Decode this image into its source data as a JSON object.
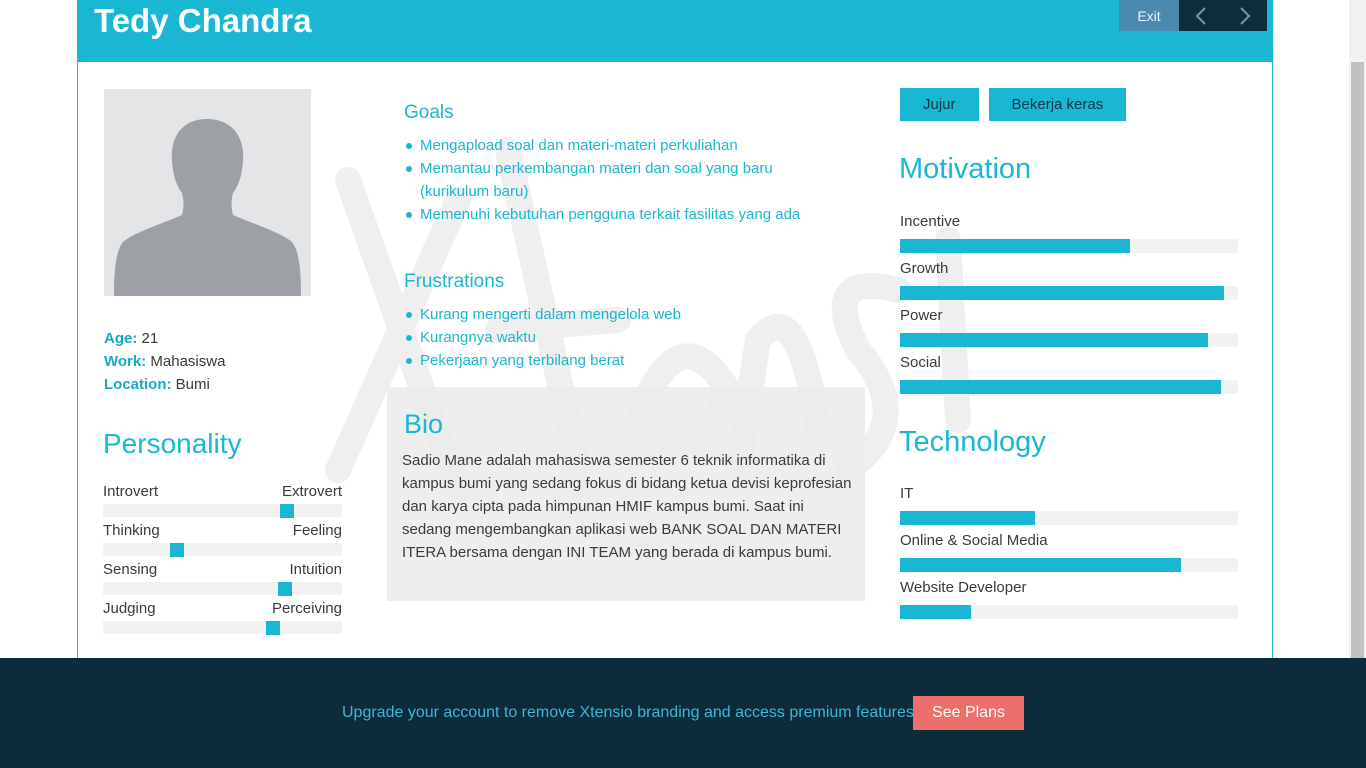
{
  "profile": {
    "name": "Tedy Chandra",
    "age_label": "Age:",
    "age": "21",
    "work_label": "Work:",
    "work": "Mahasiswa",
    "location_label": "Location:",
    "location": "Bumi"
  },
  "nav": {
    "exit": "Exit",
    "prev_icon": "chevron-left-icon",
    "next_icon": "chevron-right-icon"
  },
  "personality": {
    "title": "Personality",
    "traits": [
      {
        "left": "Introvert",
        "right": "Extrovert",
        "value": 0.77
      },
      {
        "left": "Thinking",
        "right": "Feeling",
        "value": 0.31
      },
      {
        "left": "Sensing",
        "right": "Intuition",
        "value": 0.76
      },
      {
        "left": "Judging",
        "right": "Perceiving",
        "value": 0.71
      }
    ]
  },
  "goals": {
    "title": "Goals",
    "items": [
      "Mengapload soal dan materi-materi perkuliahan",
      "Memantau perkembangan materi dan soal yang baru (kurikulum baru)",
      "Memenuhi kebutuhan pengguna terkait fasilitas yang ada"
    ]
  },
  "frustrations": {
    "title": "Frustrations",
    "items": [
      "Kurang mengerti dalam mengelola web",
      "Kurangnya waktu",
      "Pekerjaan yang terbilang berat"
    ]
  },
  "bio": {
    "title": "Bio",
    "text": "Sadio Mane adalah mahasiswa semester 6 teknik informatika di kampus bumi yang sedang fokus di bidang ketua devisi keprofesian dan karya cipta pada himpunan HMIF kampus bumi. Saat ini sedang mengembangkan aplikasi web BANK SOAL DAN MATERI ITERA bersama dengan INI TEAM yang berada di kampus bumi."
  },
  "tags": [
    "Jujur",
    "Bekerja keras"
  ],
  "motivation": {
    "title": "Motivation",
    "items": [
      {
        "label": "Incentive",
        "value": 0.68
      },
      {
        "label": "Growth",
        "value": 0.96
      },
      {
        "label": "Power",
        "value": 0.91
      },
      {
        "label": "Social",
        "value": 0.95
      }
    ]
  },
  "technology": {
    "title": "Technology",
    "items": [
      {
        "label": "IT",
        "value": 0.4
      },
      {
        "label": "Online & Social Media",
        "value": 0.83
      },
      {
        "label": "Website Developer",
        "value": 0.21
      }
    ]
  },
  "footer": {
    "message": "Upgrade your account to remove Xtensio branding and access premium features.",
    "button": "See Plans"
  },
  "colors": {
    "accent": "#19b7d2",
    "footer_bg": "#0c2b3b",
    "cta": "#ec6f6c"
  }
}
